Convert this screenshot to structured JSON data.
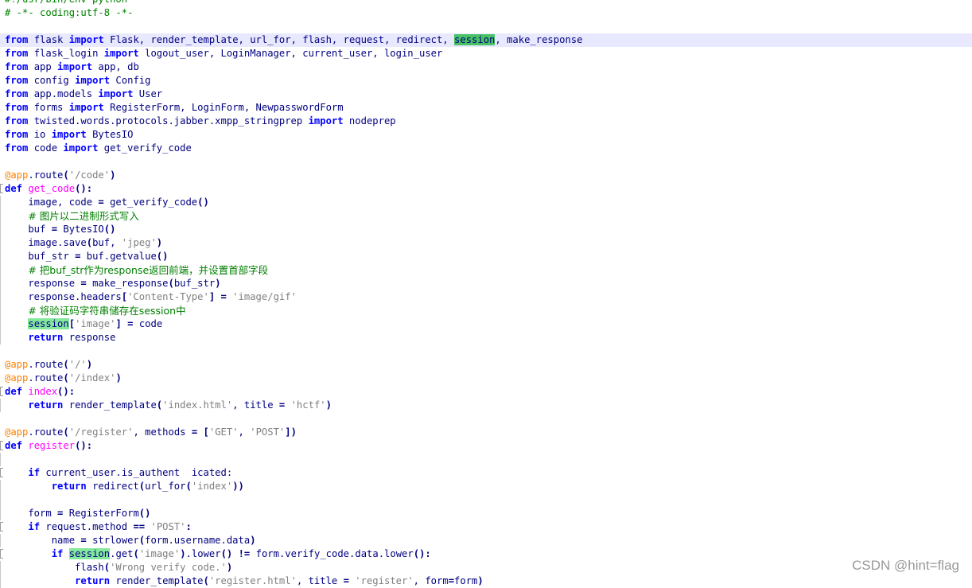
{
  "colors": {
    "keyword": "#0000ff",
    "string": "#808080",
    "comment": "#008000",
    "decorator": "#ff8000",
    "function_def": "#ff00ff",
    "identifier": "#000080",
    "highlight": "#83e89b",
    "current_line": "#e8e8ff"
  },
  "watermark": "CSDN @hint=flag",
  "lines": [
    {
      "fold": "",
      "tokens": [
        [
          "cmt",
          "#!/usr/bin/env python"
        ]
      ]
    },
    {
      "fold": "",
      "tokens": [
        [
          "cmt",
          "# -*- coding:utf-8 -*-"
        ]
      ]
    },
    {
      "fold": "",
      "tokens": []
    },
    {
      "fold": "",
      "current": true,
      "tokens": [
        [
          "kw",
          "from"
        ],
        [
          "id",
          " flask "
        ],
        [
          "kw",
          "import"
        ],
        [
          "id",
          " Flask, render_template, url_for, flash, request, redirect, "
        ],
        [
          "hl2",
          "session"
        ],
        [
          "id",
          ", make_response"
        ]
      ]
    },
    {
      "fold": "",
      "tokens": [
        [
          "kw",
          "from"
        ],
        [
          "id",
          " flask_login "
        ],
        [
          "kw",
          "import"
        ],
        [
          "id",
          " logout_user, LoginManager, current_user, login_user"
        ]
      ]
    },
    {
      "fold": "",
      "tokens": [
        [
          "kw",
          "from"
        ],
        [
          "id",
          " app "
        ],
        [
          "kw",
          "import"
        ],
        [
          "id",
          " app, db"
        ]
      ]
    },
    {
      "fold": "",
      "tokens": [
        [
          "kw",
          "from"
        ],
        [
          "id",
          " config "
        ],
        [
          "kw",
          "import"
        ],
        [
          "id",
          " Config"
        ]
      ]
    },
    {
      "fold": "",
      "tokens": [
        [
          "kw",
          "from"
        ],
        [
          "id",
          " app.models "
        ],
        [
          "kw",
          "import"
        ],
        [
          "id",
          " User"
        ]
      ]
    },
    {
      "fold": "",
      "tokens": [
        [
          "kw",
          "from"
        ],
        [
          "id",
          " forms "
        ],
        [
          "kw",
          "import"
        ],
        [
          "id",
          " RegisterForm, LoginForm, NewpasswordForm"
        ]
      ]
    },
    {
      "fold": "",
      "tokens": [
        [
          "kw",
          "from"
        ],
        [
          "id",
          " twisted.words.protocols.jabber.xmpp_stringprep "
        ],
        [
          "kw",
          "import"
        ],
        [
          "id",
          " nodeprep"
        ]
      ]
    },
    {
      "fold": "",
      "tokens": [
        [
          "kw",
          "from"
        ],
        [
          "id",
          " io "
        ],
        [
          "kw",
          "import"
        ],
        [
          "id",
          " BytesIO"
        ]
      ]
    },
    {
      "fold": "",
      "tokens": [
        [
          "kw",
          "from"
        ],
        [
          "id",
          " code "
        ],
        [
          "kw",
          "import"
        ],
        [
          "id",
          " get_verify_code"
        ]
      ]
    },
    {
      "fold": "",
      "tokens": []
    },
    {
      "fold": "",
      "tokens": [
        [
          "dec",
          "@app"
        ],
        [
          "id",
          ".route"
        ],
        [
          "op",
          "("
        ],
        [
          "str",
          "'/code'"
        ],
        [
          "op",
          ")"
        ]
      ]
    },
    {
      "fold": "start",
      "tokens": [
        [
          "kw",
          "def"
        ],
        [
          "id",
          " "
        ],
        [
          "fn",
          "get_code"
        ],
        [
          "op",
          "():"
        ]
      ]
    },
    {
      "fold": "line",
      "tokens": [
        [
          "id",
          "    image, code "
        ],
        [
          "op",
          "="
        ],
        [
          "id",
          " get_verify_code"
        ],
        [
          "op",
          "()"
        ]
      ]
    },
    {
      "fold": "line",
      "tokens": [
        [
          "id",
          "    "
        ],
        [
          "cmtcn",
          "# 图片以二进制形式写入"
        ]
      ]
    },
    {
      "fold": "line",
      "tokens": [
        [
          "id",
          "    buf "
        ],
        [
          "op",
          "="
        ],
        [
          "id",
          " BytesIO"
        ],
        [
          "op",
          "()"
        ]
      ]
    },
    {
      "fold": "line",
      "tokens": [
        [
          "id",
          "    image.save"
        ],
        [
          "op",
          "("
        ],
        [
          "id",
          "buf, "
        ],
        [
          "str",
          "'jpeg'"
        ],
        [
          "op",
          ")"
        ]
      ]
    },
    {
      "fold": "line",
      "tokens": [
        [
          "id",
          "    buf_str "
        ],
        [
          "op",
          "="
        ],
        [
          "id",
          " buf.getvalue"
        ],
        [
          "op",
          "()"
        ]
      ]
    },
    {
      "fold": "line",
      "tokens": [
        [
          "id",
          "    "
        ],
        [
          "cmtcn",
          "# 把buf_str作为response返回前端，并设置首部字段"
        ]
      ]
    },
    {
      "fold": "line",
      "tokens": [
        [
          "id",
          "    response "
        ],
        [
          "op",
          "="
        ],
        [
          "id",
          " make_response"
        ],
        [
          "op",
          "("
        ],
        [
          "id",
          "buf_str"
        ],
        [
          "op",
          ")"
        ]
      ]
    },
    {
      "fold": "line",
      "tokens": [
        [
          "id",
          "    response.headers"
        ],
        [
          "op",
          "["
        ],
        [
          "str",
          "'Content-Type'"
        ],
        [
          "op",
          "]"
        ],
        [
          "id",
          " "
        ],
        [
          "op",
          "="
        ],
        [
          "id",
          " "
        ],
        [
          "str",
          "'image/gif'"
        ]
      ]
    },
    {
      "fold": "line",
      "tokens": [
        [
          "id",
          "    "
        ],
        [
          "cmtcn",
          "# 将验证码字符串储存在session中"
        ]
      ]
    },
    {
      "fold": "line",
      "tokens": [
        [
          "id",
          "    "
        ],
        [
          "hl",
          "session"
        ],
        [
          "op",
          "["
        ],
        [
          "str",
          "'image'"
        ],
        [
          "op",
          "]"
        ],
        [
          "id",
          " "
        ],
        [
          "op",
          "="
        ],
        [
          "id",
          " code"
        ]
      ]
    },
    {
      "fold": "line",
      "tokens": [
        [
          "id",
          "    "
        ],
        [
          "kw",
          "return"
        ],
        [
          "id",
          " response"
        ]
      ]
    },
    {
      "fold": "",
      "tokens": []
    },
    {
      "fold": "",
      "tokens": [
        [
          "dec",
          "@app"
        ],
        [
          "id",
          ".route"
        ],
        [
          "op",
          "("
        ],
        [
          "str",
          "'/'"
        ],
        [
          "op",
          ")"
        ]
      ]
    },
    {
      "fold": "",
      "tokens": [
        [
          "dec",
          "@app"
        ],
        [
          "id",
          ".route"
        ],
        [
          "op",
          "("
        ],
        [
          "str",
          "'/index'"
        ],
        [
          "op",
          ")"
        ]
      ]
    },
    {
      "fold": "start",
      "tokens": [
        [
          "kw",
          "def"
        ],
        [
          "id",
          " "
        ],
        [
          "fn",
          "index"
        ],
        [
          "op",
          "():"
        ]
      ]
    },
    {
      "fold": "line",
      "tokens": [
        [
          "id",
          "    "
        ],
        [
          "kw",
          "return"
        ],
        [
          "id",
          " render_template"
        ],
        [
          "op",
          "("
        ],
        [
          "str",
          "'index.html'"
        ],
        [
          "id",
          ", title "
        ],
        [
          "op",
          "="
        ],
        [
          "id",
          " "
        ],
        [
          "str",
          "'hctf'"
        ],
        [
          "op",
          ")"
        ]
      ]
    },
    {
      "fold": "",
      "tokens": []
    },
    {
      "fold": "",
      "tokens": [
        [
          "dec",
          "@app"
        ],
        [
          "id",
          ".route"
        ],
        [
          "op",
          "("
        ],
        [
          "str",
          "'/register'"
        ],
        [
          "id",
          ", methods "
        ],
        [
          "op",
          "="
        ],
        [
          "id",
          " "
        ],
        [
          "op",
          "["
        ],
        [
          "str",
          "'GET'"
        ],
        [
          "id",
          ", "
        ],
        [
          "str",
          "'POST'"
        ],
        [
          "op",
          "])"
        ]
      ]
    },
    {
      "fold": "start",
      "tokens": [
        [
          "kw",
          "def"
        ],
        [
          "id",
          " "
        ],
        [
          "fn",
          "register"
        ],
        [
          "op",
          "():"
        ]
      ]
    },
    {
      "fold": "line",
      "tokens": []
    },
    {
      "fold": "start",
      "tokens": [
        [
          "id",
          "    "
        ],
        [
          "kw",
          "if"
        ],
        [
          "id",
          " current_user.is_authent  icated:"
        ]
      ]
    },
    {
      "fold": "line",
      "tokens": [
        [
          "id",
          "        "
        ],
        [
          "kw",
          "return"
        ],
        [
          "id",
          " redirect"
        ],
        [
          "op",
          "("
        ],
        [
          "id",
          "url_for"
        ],
        [
          "op",
          "("
        ],
        [
          "str",
          "'index'"
        ],
        [
          "op",
          "))"
        ]
      ]
    },
    {
      "fold": "line",
      "tokens": []
    },
    {
      "fold": "line",
      "tokens": [
        [
          "id",
          "    form "
        ],
        [
          "op",
          "="
        ],
        [
          "id",
          " RegisterForm"
        ],
        [
          "op",
          "()"
        ]
      ]
    },
    {
      "fold": "start",
      "tokens": [
        [
          "id",
          "    "
        ],
        [
          "kw",
          "if"
        ],
        [
          "id",
          " request.method "
        ],
        [
          "op",
          "=="
        ],
        [
          "id",
          " "
        ],
        [
          "str",
          "'POST'"
        ],
        [
          "op",
          ":"
        ]
      ]
    },
    {
      "fold": "line",
      "tokens": [
        [
          "id",
          "        name "
        ],
        [
          "op",
          "="
        ],
        [
          "id",
          " strlower"
        ],
        [
          "op",
          "("
        ],
        [
          "id",
          "form.username.data"
        ],
        [
          "op",
          ")"
        ]
      ]
    },
    {
      "fold": "start",
      "tokens": [
        [
          "id",
          "        "
        ],
        [
          "kw",
          "if"
        ],
        [
          "id",
          " "
        ],
        [
          "hl",
          "session"
        ],
        [
          "id",
          ".get"
        ],
        [
          "op",
          "("
        ],
        [
          "str",
          "'image'"
        ],
        [
          "op",
          ")"
        ],
        [
          "id",
          ".lower"
        ],
        [
          "op",
          "()"
        ],
        [
          "id",
          " "
        ],
        [
          "op",
          "!="
        ],
        [
          "id",
          " form.verify_code.data.lower"
        ],
        [
          "op",
          "():"
        ]
      ]
    },
    {
      "fold": "line",
      "tokens": [
        [
          "id",
          "            flash"
        ],
        [
          "op",
          "("
        ],
        [
          "str",
          "'Wrong verify code.'"
        ],
        [
          "op",
          ")"
        ]
      ]
    },
    {
      "fold": "line",
      "tokens": [
        [
          "id",
          "            "
        ],
        [
          "kw",
          "return"
        ],
        [
          "id",
          " render_template"
        ],
        [
          "op",
          "("
        ],
        [
          "str",
          "'register.html'"
        ],
        [
          "id",
          ", title "
        ],
        [
          "op",
          "="
        ],
        [
          "id",
          " "
        ],
        [
          "str",
          "'register'"
        ],
        [
          "id",
          ", form"
        ],
        [
          "op",
          "="
        ],
        [
          "id",
          "form"
        ],
        [
          "op",
          ")"
        ]
      ]
    }
  ]
}
